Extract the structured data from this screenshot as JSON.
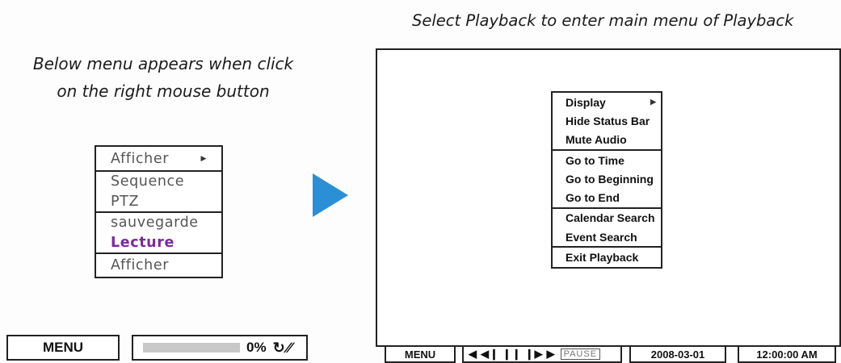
{
  "captions": {
    "left_line1": "Below menu appears when click",
    "left_line2": "on the right mouse button",
    "right": "Select Playback to enter main menu of Playback"
  },
  "left_menu": {
    "groups": [
      [
        {
          "label": "Afficher",
          "submenu": true
        }
      ],
      [
        {
          "label": "Sequence"
        },
        {
          "label": "PTZ"
        }
      ],
      [
        {
          "label": "sauvegarde"
        },
        {
          "label": "Lecture",
          "active": true
        }
      ],
      [
        {
          "label": "Afficher"
        }
      ]
    ]
  },
  "left_bar": {
    "menu_label": "MENU",
    "progress_value": "0%",
    "icons": [
      "refresh-icon",
      "no-audio-icon"
    ]
  },
  "right_menu": {
    "groups": [
      [
        {
          "label": "Display",
          "submenu": true
        },
        {
          "label": "Hide Status Bar"
        },
        {
          "label": "Mute Audio"
        }
      ],
      [
        {
          "label": "Go to Time"
        },
        {
          "label": "Go to Beginning"
        },
        {
          "label": "Go to End"
        }
      ],
      [
        {
          "label": "Calendar Search"
        },
        {
          "label": "Event Search"
        }
      ],
      [
        {
          "label": "Exit Playback"
        }
      ]
    ]
  },
  "right_bar": {
    "menu_label": "MENU",
    "pause_label": "PAUSE",
    "date": "2008-03-01",
    "time": "12:00:00 AM"
  },
  "colors": {
    "arrow": "#2b8fd6",
    "active_item": "#7b2a9d",
    "progress_fill": "#c8c8c8"
  }
}
